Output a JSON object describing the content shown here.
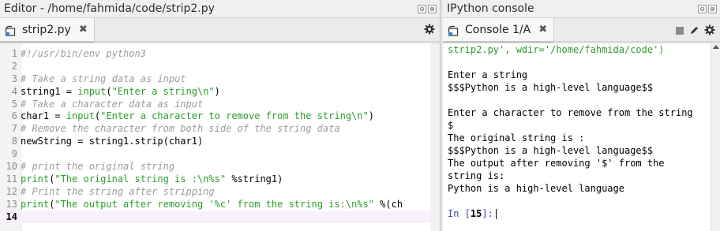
{
  "editor": {
    "title": "Editor - /home/fahmida/code/strip2.py",
    "tab_label": "strip2.py",
    "close_glyph": "✖",
    "window_buttons": [
      "⊖",
      "⊗"
    ],
    "lines": [
      {
        "n": "1",
        "segs": [
          [
            "cmt",
            "#!/usr/bin/env python3"
          ]
        ]
      },
      {
        "n": "2",
        "segs": []
      },
      {
        "n": "3",
        "segs": [
          [
            "cmt",
            "# Take a string data as input"
          ]
        ]
      },
      {
        "n": "4",
        "segs": [
          [
            "",
            "string1 = "
          ],
          [
            "kw",
            "input"
          ],
          [
            "",
            "("
          ],
          [
            "str",
            "\"Enter a string\\n\""
          ],
          [
            "",
            ")"
          ]
        ]
      },
      {
        "n": "5",
        "segs": [
          [
            "cmt",
            "# Take a character data as input"
          ]
        ]
      },
      {
        "n": "6",
        "segs": [
          [
            "",
            "char1 = "
          ],
          [
            "kw",
            "input"
          ],
          [
            "",
            "("
          ],
          [
            "str",
            "\"Enter a character to remove from the string\\n\""
          ],
          [
            "",
            ")"
          ]
        ]
      },
      {
        "n": "7",
        "segs": [
          [
            "cmt",
            "# Remove the character from both side of the string data"
          ]
        ]
      },
      {
        "n": "8",
        "segs": [
          [
            "",
            "newString = string1.strip(char1)"
          ]
        ]
      },
      {
        "n": "9",
        "segs": []
      },
      {
        "n": "10",
        "segs": [
          [
            "cmt",
            "# print the original string"
          ]
        ]
      },
      {
        "n": "11",
        "segs": [
          [
            "kw",
            "print"
          ],
          [
            "",
            "("
          ],
          [
            "str",
            "\"The original string is :\\n%s\""
          ],
          [
            "",
            " %string1)"
          ]
        ]
      },
      {
        "n": "12",
        "segs": [
          [
            "cmt",
            "# Print the string after stripping"
          ]
        ]
      },
      {
        "n": "13",
        "segs": [
          [
            "kw",
            "print"
          ],
          [
            "",
            "("
          ],
          [
            "str",
            "\"The output after removing '%c' from the string is:\\n%s\""
          ],
          [
            "",
            " %(ch"
          ]
        ]
      },
      {
        "n": "14",
        "segs": [],
        "current": true
      }
    ]
  },
  "console": {
    "title": "IPython console",
    "tab_label": "Console 1/A",
    "close_glyph": "✖",
    "window_buttons": [
      "⊖",
      "⊗"
    ],
    "lines": [
      {
        "cls": "green",
        "text": "strip2.py', wdir='/home/fahmida/code')"
      },
      {
        "cls": "",
        "text": ""
      },
      {
        "cls": "",
        "text": "Enter a string"
      },
      {
        "cls": "",
        "text": "$$$Python is a high-level language$$"
      },
      {
        "cls": "",
        "text": ""
      },
      {
        "cls": "",
        "text": "Enter a character to remove from the string"
      },
      {
        "cls": "",
        "text": "$"
      },
      {
        "cls": "",
        "text": "The original string is :"
      },
      {
        "cls": "",
        "text": "$$$Python is a high-level language$$"
      },
      {
        "cls": "",
        "text": "The output after removing '$' from the"
      },
      {
        "cls": "",
        "text": "string is:"
      },
      {
        "cls": "",
        "text": "Python is a high-level language"
      },
      {
        "cls": "",
        "text": ""
      }
    ],
    "prompt_label": "In [",
    "prompt_number": "15",
    "prompt_suffix": "]:"
  }
}
